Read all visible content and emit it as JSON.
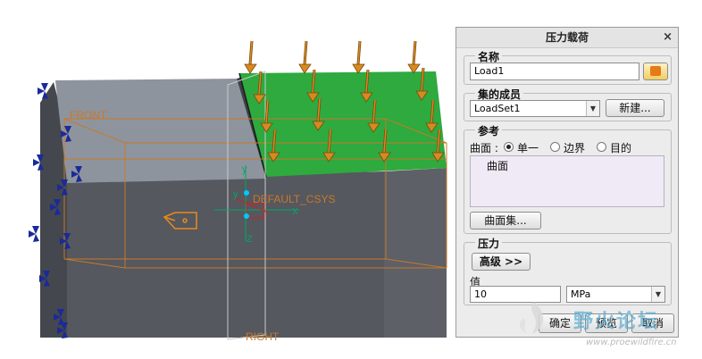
{
  "viewport": {
    "datum_front": "FRONT",
    "datum_right": "RIGHT",
    "csys_label": "DEFAULT_CSYS",
    "axis_x": "X",
    "axis_y": "y",
    "axis_z": "Z",
    "load_color": "#d98a1e",
    "surface_color": "#2eaa3e",
    "constraint_color": "#1a2a9a"
  },
  "dialog": {
    "title": "压力载荷",
    "close_label": "×",
    "name_group": {
      "label": "名称",
      "value": "Load1",
      "icon": "color-swatch-icon"
    },
    "member_group": {
      "label": "集的成员",
      "selected": "LoadSet1",
      "new_button": "新建..."
    },
    "reference_group": {
      "label": "参考",
      "type_label": "曲面 :",
      "options": [
        "单一",
        "边界",
        "目的"
      ],
      "selected_option": "单一",
      "list_items": [
        "曲面"
      ],
      "surface_set_button": "曲面集..."
    },
    "pressure_group": {
      "label": "压力",
      "advanced_button": "高级 >>",
      "value_label": "值",
      "value": "10",
      "unit": "MPa"
    },
    "buttons": {
      "ok": "确定",
      "preview": "预览",
      "cancel": "取消"
    }
  },
  "watermark": {
    "text": "野火论坛",
    "url": "www.proewildfire.cn"
  }
}
